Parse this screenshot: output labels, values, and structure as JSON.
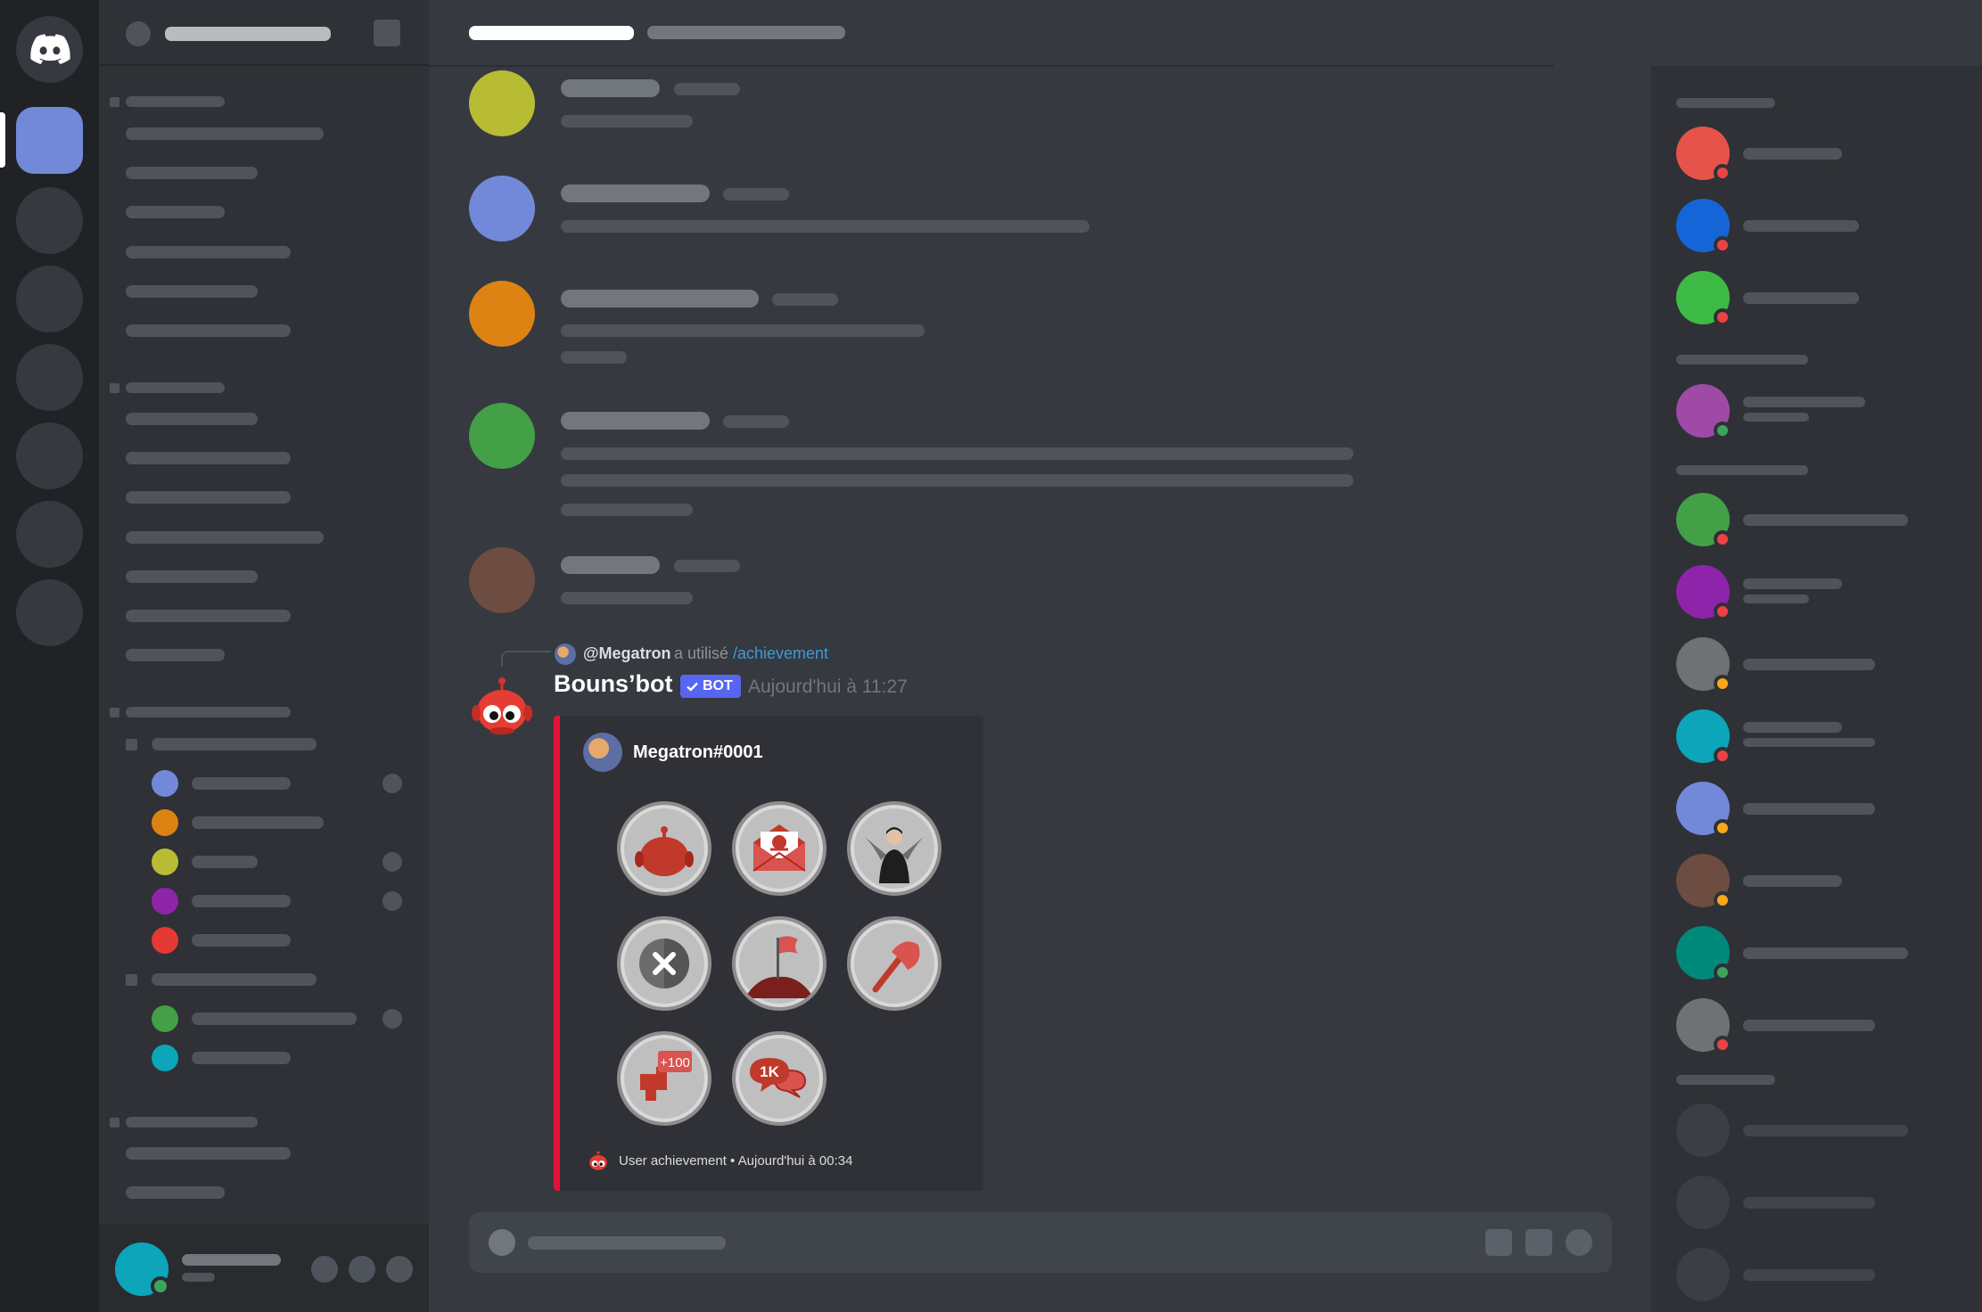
{
  "bot_message": {
    "reply_user": "@Megatron",
    "reply_action": "a utilisé",
    "reply_command": "/achievement",
    "bot_name": "Bouns’bot",
    "bot_badge": "BOT",
    "timestamp": "Aujourd'hui à 11:27",
    "embed": {
      "author": "Megatron#0001",
      "badges": [
        {
          "name": "bot-head-badge",
          "label": ""
        },
        {
          "name": "mail-badge",
          "label": ""
        },
        {
          "name": "person-wings-badge",
          "label": ""
        },
        {
          "name": "close-badge",
          "label": ""
        },
        {
          "name": "flag-badge",
          "label": ""
        },
        {
          "name": "axe-badge",
          "label": ""
        },
        {
          "name": "plus-100-badge",
          "label": "+100"
        },
        {
          "name": "messages-1k-badge",
          "label": "1K"
        }
      ],
      "footer": "User achievement • Aujourd'hui à 00:34"
    }
  },
  "colors": {
    "accent": "#5865f2",
    "embed_border": "#e3123a",
    "link": "#3d9bd6",
    "status_online": "#3ba55d",
    "status_dnd": "#ed4245",
    "status_idle": "#faa81a"
  },
  "icons": {
    "home": "discord-logo-icon",
    "check": "check-icon"
  }
}
